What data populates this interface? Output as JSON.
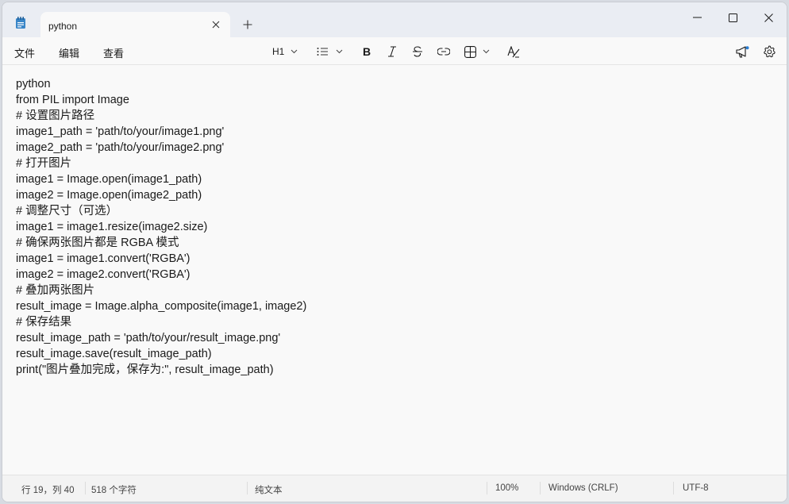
{
  "titlebar": {
    "tab_title": "python",
    "close_tab_icon": "close-icon",
    "new_tab_icon": "plus-icon",
    "window_controls": [
      "minimize-icon",
      "maximize-icon",
      "close-icon"
    ]
  },
  "menu": {
    "file": "文件",
    "edit": "编辑",
    "view": "查看"
  },
  "toolbar": {
    "heading": "H1",
    "list_icon": "bullet-list-icon",
    "bold_icon": "bold-icon",
    "italic_icon": "italic-icon",
    "strike_icon": "strikethrough-icon",
    "link_icon": "link-icon",
    "table_icon": "table-icon",
    "clear_format_icon": "clear-formatting-icon",
    "announce_icon": "megaphone-icon",
    "settings_icon": "gear-icon"
  },
  "editor": {
    "lines": [
      "python",
      "from PIL import Image",
      "# 设置图片路径",
      "image1_path = 'path/to/your/image1.png'",
      "image2_path = 'path/to/your/image2.png'",
      "# 打开图片",
      "image1 = Image.open(image1_path)",
      "image2 = Image.open(image2_path)",
      "# 调整尺寸（可选）",
      "image1 = image1.resize(image2.size)",
      "# 确保两张图片都是 RGBA 模式",
      "image1 = image1.convert('RGBA')",
      "image2 = image2.convert('RGBA')",
      "# 叠加两张图片",
      "result_image = Image.alpha_composite(image1, image2)",
      "# 保存结果",
      "result_image_path = 'path/to/your/result_image.png'",
      "result_image.save(result_image_path)",
      "print(\"图片叠加完成，保存为:\", result_image_path)"
    ]
  },
  "status": {
    "position": "行 19，列 40",
    "chars": "518 个字符",
    "format": "纯文本",
    "zoom": "100%",
    "line_ending": "Windows (CRLF)",
    "encoding": "UTF-8"
  },
  "colors": {
    "titlebar_bg": "#eaedf3",
    "editor_bg": "#f9f9f9",
    "app_icon": "#3a86c8"
  }
}
